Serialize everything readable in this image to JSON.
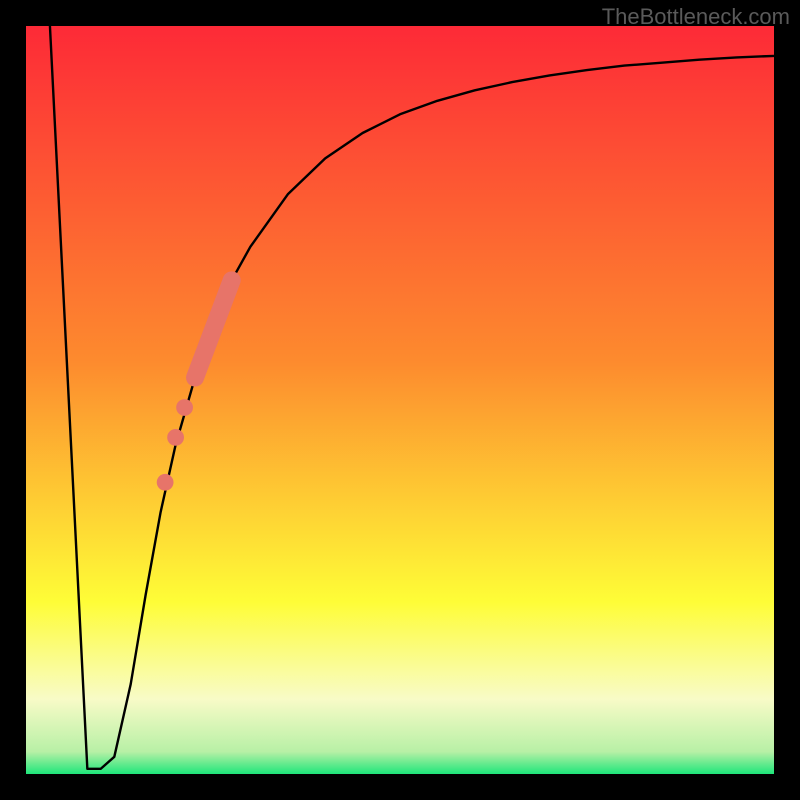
{
  "watermark": "TheBottleneck.com",
  "colors": {
    "border": "#000000",
    "curve": "#000000",
    "marker": "#e77469",
    "gradient_top": "#fd2a37",
    "gradient_mid1": "#fd8b2e",
    "gradient_mid2": "#fefd37",
    "gradient_bottom": "#1ee67a",
    "bottom_band": "#f8fbc7"
  },
  "chart_data": {
    "type": "line",
    "title": "",
    "xlabel": "",
    "ylabel": "",
    "xlim": [
      0,
      100
    ],
    "ylim": [
      0,
      100
    ],
    "series": [
      {
        "name": "curve",
        "x": [
          3.2,
          6.5,
          8.2,
          10.0,
          11.8,
          14.0,
          16.0,
          18.0,
          20.0,
          22.6,
          25.0,
          27.5,
          30.0,
          35.0,
          40.0,
          45.0,
          50.0,
          55.0,
          60.0,
          65.0,
          70.0,
          75.0,
          80.0,
          85.0,
          90.0,
          95.0,
          100.0
        ],
        "y": [
          100.0,
          26.0,
          2.3,
          0.7,
          2.3,
          12.0,
          24.0,
          35.0,
          44.0,
          53.0,
          60.0,
          66.0,
          70.5,
          77.5,
          82.3,
          85.7,
          88.2,
          90.0,
          91.4,
          92.5,
          93.4,
          94.1,
          94.7,
          95.1,
          95.5,
          95.8,
          96.0
        ]
      }
    ],
    "markers": [
      {
        "type": "segment",
        "x1": 22.6,
        "y1": 53.0,
        "x2": 27.5,
        "y2": 66.0,
        "thickness": 3.0
      },
      {
        "type": "dot",
        "x": 21.2,
        "y": 49.0,
        "r": 1.4
      },
      {
        "type": "dot",
        "x": 20.0,
        "y": 45.0,
        "r": 1.4
      },
      {
        "type": "dot",
        "x": 18.6,
        "y": 39.0,
        "r": 1.4
      }
    ],
    "dip_x": 9.1,
    "flat_bottom_width": 1.8
  }
}
